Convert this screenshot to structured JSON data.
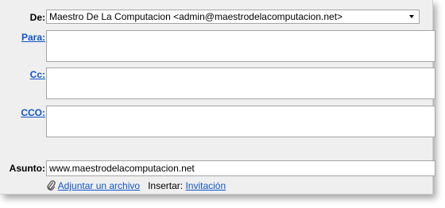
{
  "compose": {
    "from_label": "De:",
    "from_value": "Maestro De La Computacion <admin@maestrodelacomputacion.net>",
    "to_label": "Para:",
    "cc_label": "Cc:",
    "bcc_label": "CCO:",
    "subject_label": "Asunto:",
    "subject_value": "www.maestrodelacomputacion.net",
    "attach_label": "Adjuntar un archivo",
    "insert_label": "Insertar:",
    "invite_label": "Invitación"
  },
  "icons": {
    "attach": "paperclip-icon",
    "dropdown": "chevron-down-icon"
  },
  "colors": {
    "link": "#1155cc",
    "panel_bg": "#efefef",
    "field_border": "#a5a5a5"
  }
}
